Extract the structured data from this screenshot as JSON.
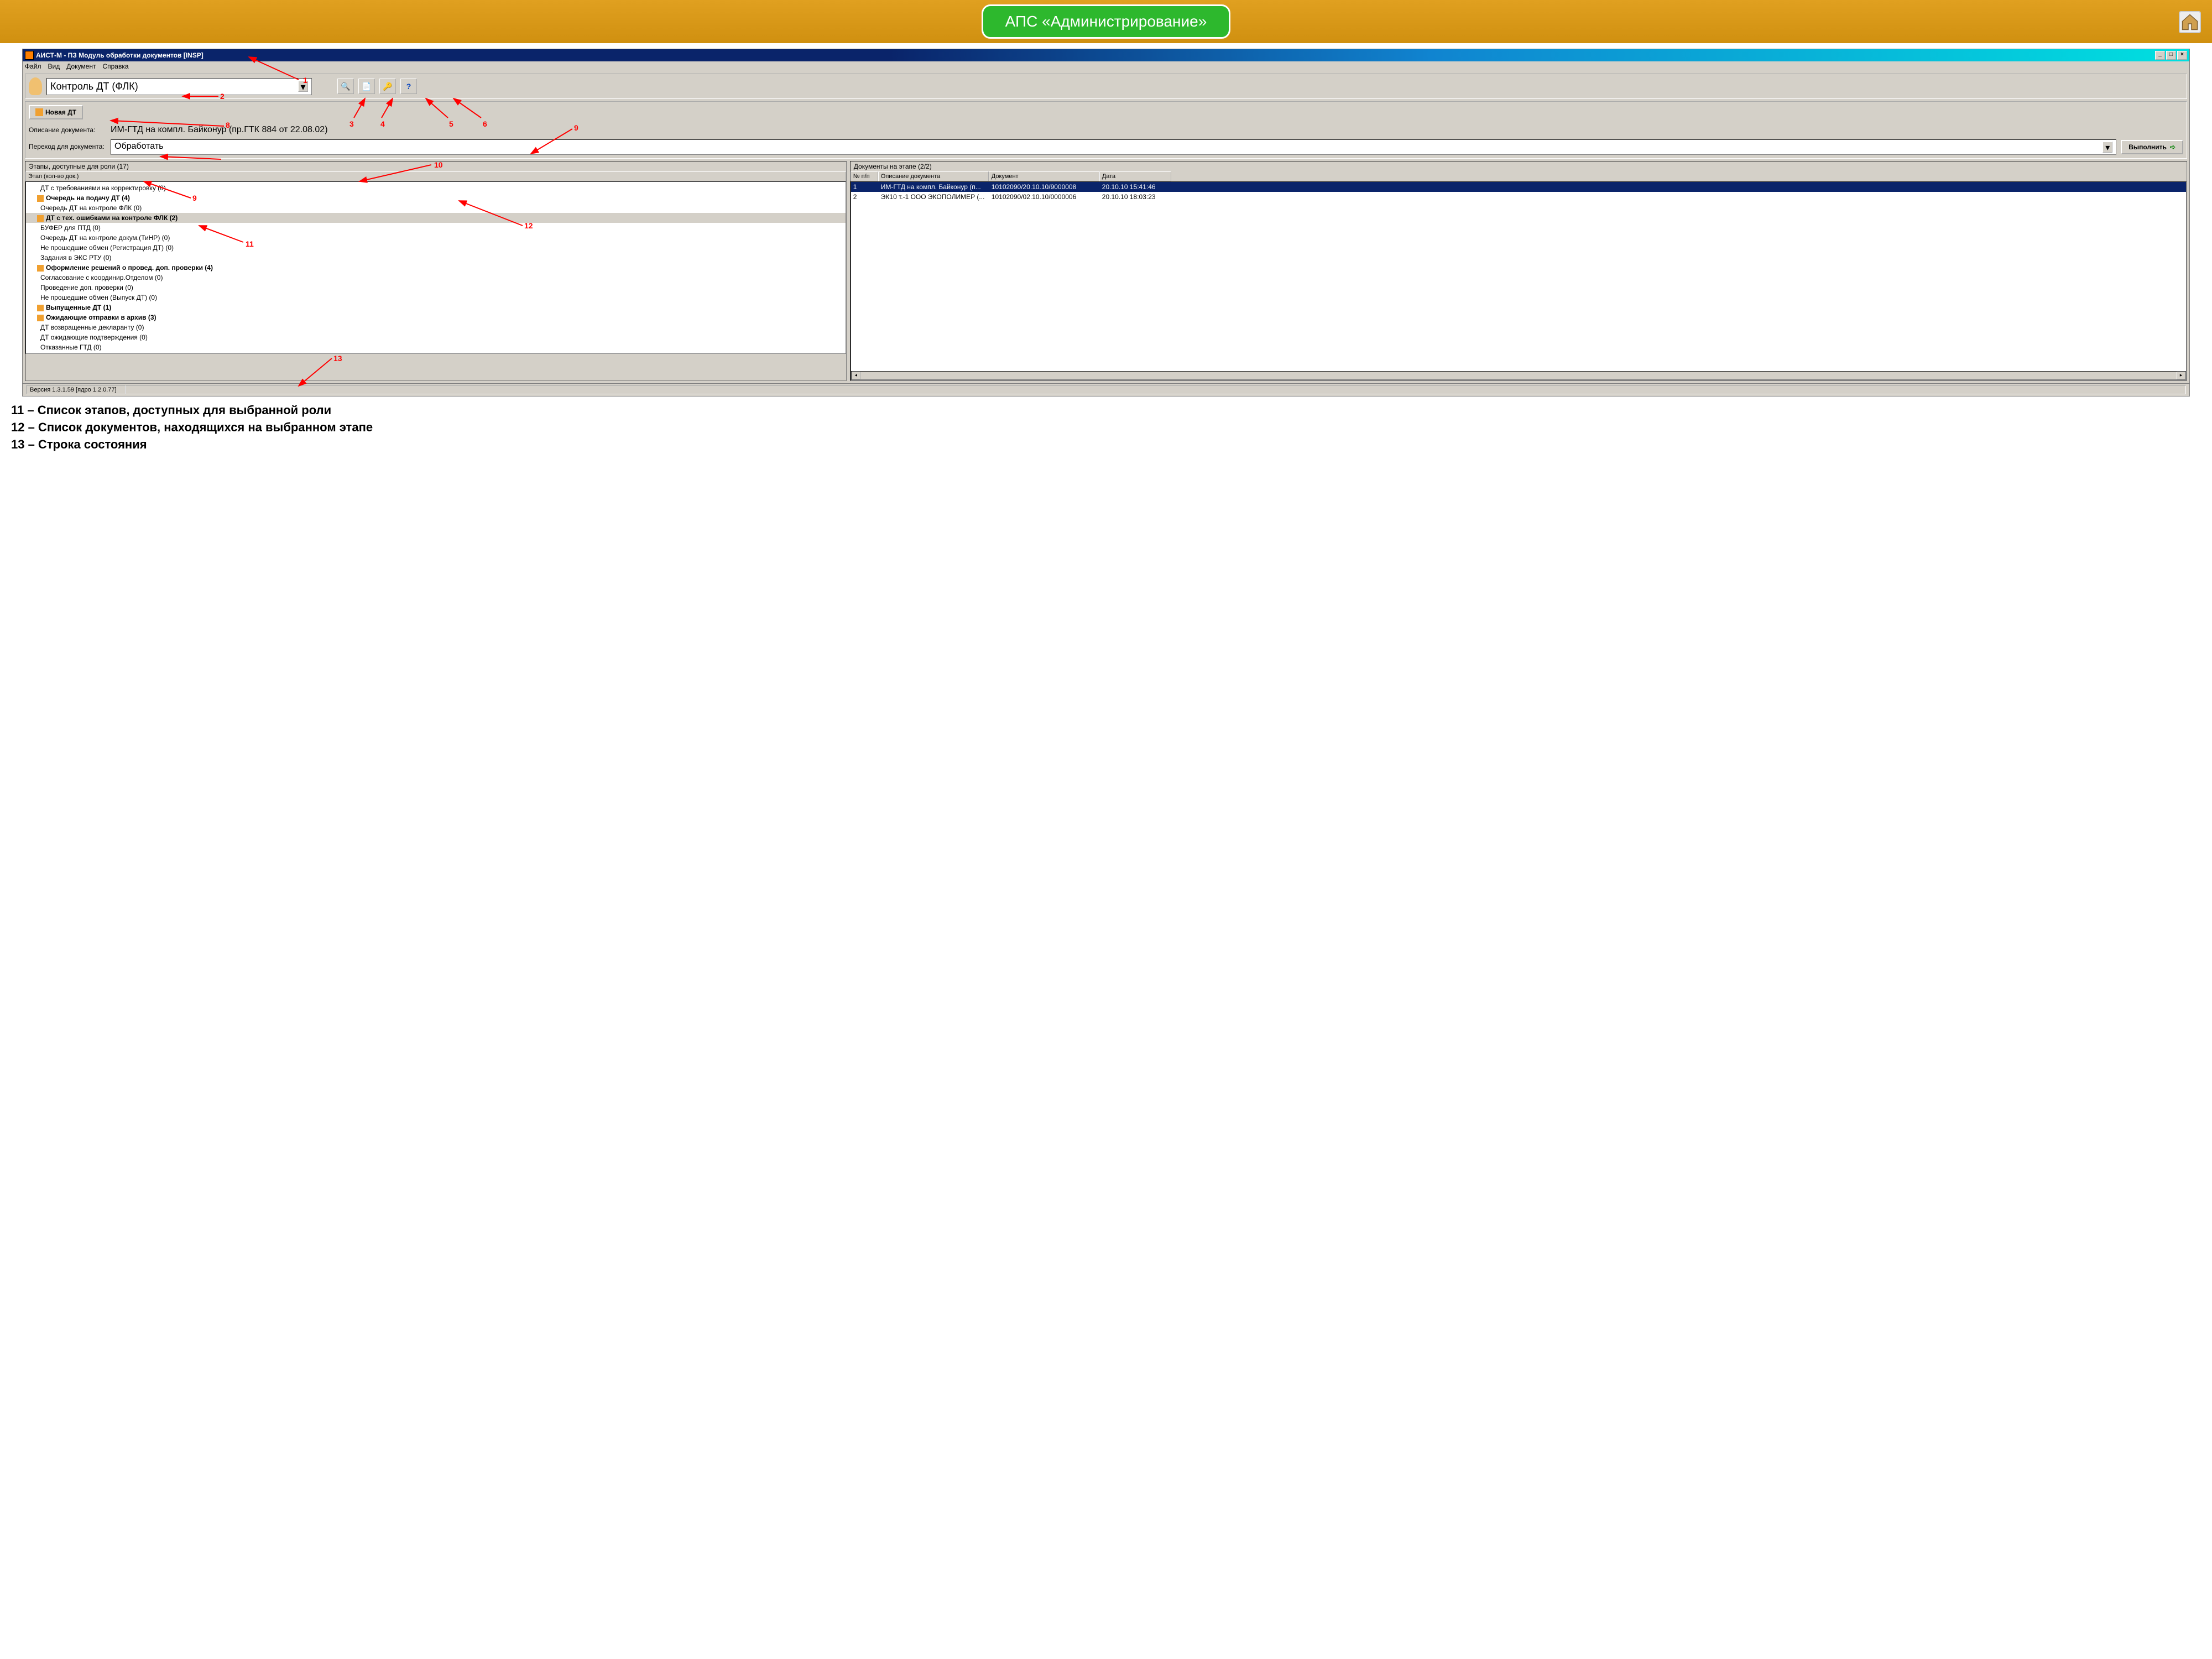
{
  "slide": {
    "title": "АПС «Администрирование»"
  },
  "window": {
    "title": "АИСТ-М - ПЗ Модуль обработки документов [INSP]",
    "menu": {
      "file": "Файл",
      "view": "Вид",
      "document": "Документ",
      "help": "Справка"
    }
  },
  "toolbar": {
    "role_value": "Контроль ДТ (ФЛК)"
  },
  "subbar": {
    "new_button": "Новая ДТ",
    "desc_label": "Описание документа:",
    "desc_value": "ИМ-ГТД на компл. Байконур (пр.ГТК 884 от 22.08.02)",
    "trans_label": "Переход для документа:",
    "trans_value": "Обработать",
    "exec_button": "Выполнить"
  },
  "left_panel": {
    "title": "Этапы, доступные для роли (17)",
    "header": "Этап (кол-во док.)",
    "items": [
      {
        "text": "ДТ с требованиями на корректировку (0)",
        "bold": false
      },
      {
        "text": "Очередь на подачу ДТ (4)",
        "bold": true
      },
      {
        "text": "Очередь ДТ на контроле ФЛК (0)",
        "bold": false
      },
      {
        "text": "ДТ с тех. ошибками на контроле ФЛК (2)",
        "bold": true,
        "selected": true
      },
      {
        "text": "БУФЕР для ПТД (0)",
        "bold": false
      },
      {
        "text": "Очередь ДТ на контроле докум.(ТиНР) (0)",
        "bold": false
      },
      {
        "text": "Не прошедшие обмен (Регистрация ДТ) (0)",
        "bold": false
      },
      {
        "text": "Задания в ЭКС РТУ (0)",
        "bold": false
      },
      {
        "text": "Оформление решений о провед. доп. проверки (4)",
        "bold": true
      },
      {
        "text": "Согласование с координир.Отделом (0)",
        "bold": false
      },
      {
        "text": "Проведение доп. проверки (0)",
        "bold": false
      },
      {
        "text": "Не прошедшие обмен (Выпуск ДТ) (0)",
        "bold": false
      },
      {
        "text": "Выпущенные ДТ (1)",
        "bold": true
      },
      {
        "text": "Ожидающие отправки в архив (3)",
        "bold": true
      },
      {
        "text": "ДТ возвращенные декларанту (0)",
        "bold": false
      },
      {
        "text": "ДТ ожидающие подтверждения (0)",
        "bold": false
      },
      {
        "text": "Отказанные ГТД (0)",
        "bold": false
      }
    ]
  },
  "right_panel": {
    "title": "Документы на этапе (2/2)",
    "columns": {
      "n": "№ п/п",
      "desc": "Описание документа",
      "doc": "Документ",
      "date": "Дата"
    },
    "rows": [
      {
        "n": "1",
        "desc": "ИМ-ГТД на компл. Байконур (п...",
        "doc": "10102090/20.10.10/9000008",
        "date": "20.10.10 15:41:46",
        "selected": true
      },
      {
        "n": "2",
        "desc": "ЭК10 т.-1 ООО ЭКОПОЛИМЕР (...",
        "doc": "10102090/02.10.10/0000006",
        "date": "20.10.10 18:03:23",
        "selected": false
      }
    ]
  },
  "statusbar": {
    "version": "Версия 1.3.1.59 [ядро 1.2.0.77]"
  },
  "annotations": {
    "1": "1",
    "2": "2",
    "3": "3",
    "4": "4",
    "5": "5",
    "6": "6",
    "8": "8",
    "9a": "9",
    "9b": "9",
    "10": "10",
    "11": "11",
    "12": "12",
    "13": "13"
  },
  "footer": {
    "line11": "11 – Список этапов, доступных для выбранной роли",
    "line12": "12 – Список документов, находящихся на выбранном этапе",
    "line13": "13 – Строка состояния"
  }
}
